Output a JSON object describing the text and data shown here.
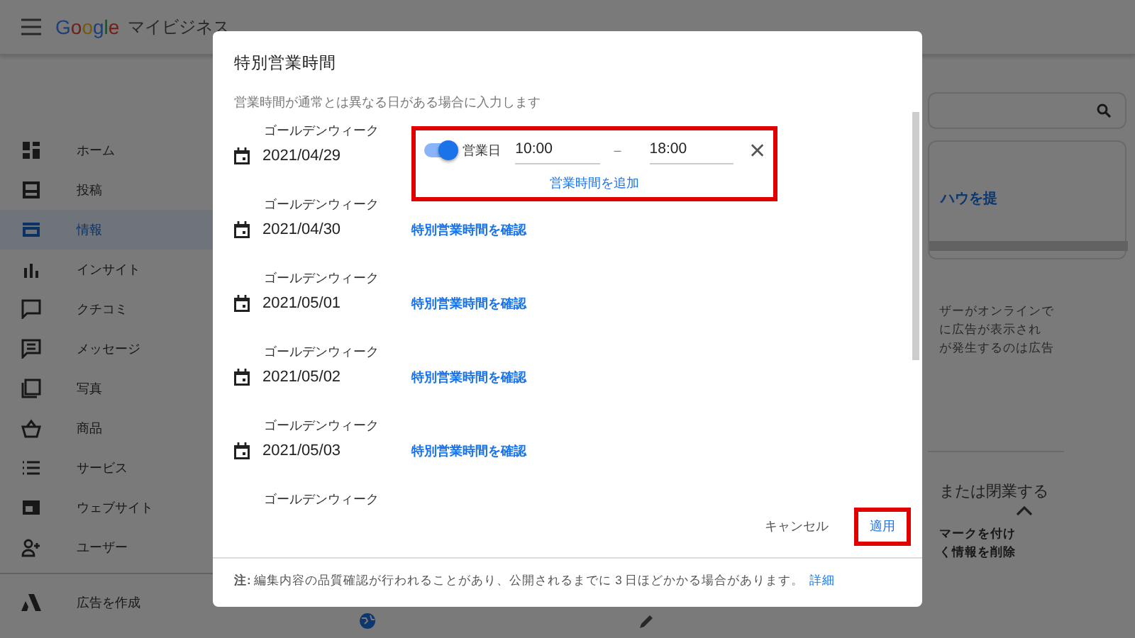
{
  "app_bar": {
    "brand": "Google",
    "title": "マイビジネス"
  },
  "sidebar": {
    "items": [
      {
        "label": "ホーム",
        "selected": false
      },
      {
        "label": "投稿",
        "selected": false
      },
      {
        "label": "情報",
        "selected": true
      },
      {
        "label": "インサイト",
        "selected": false
      },
      {
        "label": "クチコミ",
        "selected": false
      },
      {
        "label": "メッセージ",
        "selected": false
      },
      {
        "label": "写真",
        "selected": false
      },
      {
        "label": "商品",
        "selected": false
      },
      {
        "label": "サービス",
        "selected": false
      },
      {
        "label": "ウェブサイト",
        "selected": false
      },
      {
        "label": "ユーザー",
        "selected": false
      }
    ],
    "extra": "広告を作成"
  },
  "background": {
    "card_text": "ハウを提",
    "description": [
      "ザーがオンラインで",
      "に広告が表示され",
      "が発生するのは広告"
    ],
    "section_title": "または閉業する",
    "section_lines": [
      "マークを付け",
      "く情報を削除"
    ]
  },
  "dialog": {
    "title": "特別営業時間",
    "subtitle": "営業時間が通常とは異なる日がある場合に入力します",
    "entries": [
      {
        "kind": "editing",
        "label": "ゴールデンウィーク",
        "date": "2021/04/29",
        "highlighted": true,
        "open_toggle": true,
        "toggle_label": "営業日",
        "open": "10:00",
        "separator": "–",
        "close": "18:00",
        "add_link": "営業時間を追加"
      },
      {
        "kind": "link",
        "label": "ゴールデンウィーク",
        "date": "2021/04/30",
        "link": "特別営業時間を確認"
      },
      {
        "kind": "link",
        "label": "ゴールデンウィーク",
        "date": "2021/05/01",
        "link": "特別営業時間を確認"
      },
      {
        "kind": "link",
        "label": "ゴールデンウィーク",
        "date": "2021/05/02",
        "link": "特別営業時間を確認"
      },
      {
        "kind": "link",
        "label": "ゴールデンウィーク",
        "date": "2021/05/03",
        "link": "特別営業時間を確認"
      },
      {
        "kind": "label",
        "label": "ゴールデンウィーク"
      }
    ],
    "cancel": "キャンセル",
    "apply": {
      "label": "適用",
      "highlighted": true
    },
    "note": "**注:** 編集内容の品質確認が行われることがあり、公開されるまでに 3 日ほどかかる場合があります。",
    "note_link": "詳細"
  }
}
